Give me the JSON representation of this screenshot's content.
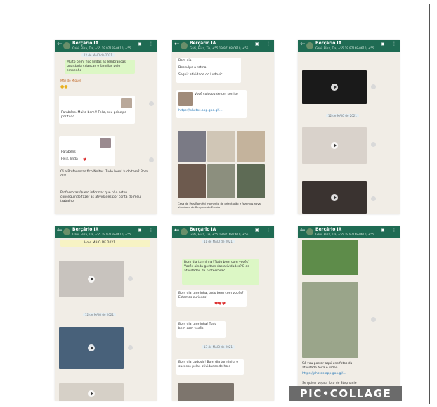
{
  "collage": {
    "watermark": "PIC•COLLAGE"
  },
  "chat": {
    "title": "Berçário IA",
    "subtitle": "Gabi, Elisa, Tia, +55 19 97168-0610, +55..."
  },
  "panel1": {
    "date1": "12 de MAIO de 2021",
    "msg1": "Muito bem, fico lindas as lembranças guardaria crianças e famílias pelo empenho",
    "sender1": "Mãe do Miguel",
    "text1": "Parabéns. Muito bem!! Feliz, seu príncipe por tudo",
    "text2": "Parabéns",
    "text3": "Feliz, linda",
    "text4": "Oi a Professoras fico Noites. Tudo bem! tudo tem? Bom dia!",
    "text5": "Professoras Quero informar que não estou conseguindo fazer as atividades por conta do meu trabalho"
  },
  "panel2": {
    "text1": "Bom dia",
    "text2": "Desculpe a rotina",
    "text3": "Seguir atividade do Ludovic",
    "text4": "Você colocou de um sorriso",
    "link": "https://photos.app.goo.gl/…",
    "note": "Casa de Pais Bom fui momento de orientação e fazemos nova atividade de Berçário da Escola"
  },
  "panel3": {
    "date1": "12 de MAIO de 2021"
  },
  "panel4": {
    "banner": "Hoje MAIO DE 2021",
    "date1": "12 de MAIO de 2021"
  },
  "panel5": {
    "date1": "11 de MAIO de 2021",
    "msg1": "Bom dia turminha! Tudo bem com vocês? Vocês ainda gostam das atividades? E as atividades da professora?",
    "text1": "Bom dia turminha, tudo bem com vocês? Estamos curiosos!",
    "text2": "Bom dia turminha! Tudo bem com vocês!",
    "date2": "13 de MAIO de 2021",
    "text3": "Bom dia Ludovic! Bom dia turminha e sucesso pelas atividades de hoje"
  },
  "panel6": {
    "text1": "Só vou postar aqui uns fotos da atividade feita e vídeo",
    "link": "https://photos.app.goo.gl/…",
    "text2": "Se quiser veja a foto de Stephanie"
  }
}
